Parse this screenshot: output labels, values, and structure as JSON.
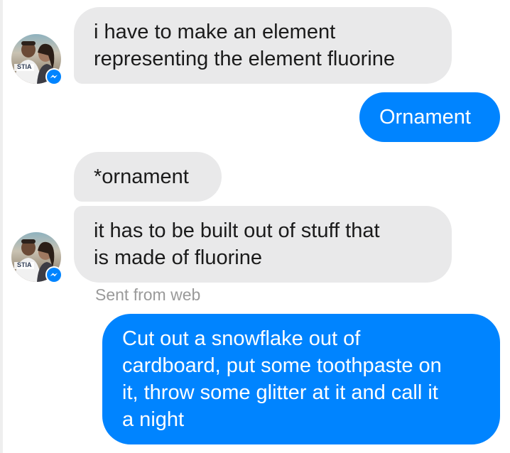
{
  "conversation": {
    "messages": [
      {
        "sender": "contact",
        "text": "i have to make an element\nrepresenting the element fluorine"
      },
      {
        "sender": "self",
        "text": "Ornament"
      },
      {
        "sender": "contact",
        "text": "*ornament"
      },
      {
        "sender": "contact",
        "text": "it has to be built out of stuff that\nis made of fluorine"
      },
      {
        "sender": "self",
        "text": "Cut out a snowflake out of\ncardboard, put some toothpaste on\nit, throw some glitter at it and call it\na night"
      }
    ],
    "sent_from": "Sent from web"
  },
  "avatar": {
    "shirt_text": "STIA"
  },
  "colors": {
    "outgoing_bubble": "#0084ff",
    "incoming_bubble": "#e9e9ea",
    "meta_text": "#9a9a9a",
    "messenger_badge": "#0084ff"
  },
  "icons": {
    "badge": "messenger-icon"
  }
}
